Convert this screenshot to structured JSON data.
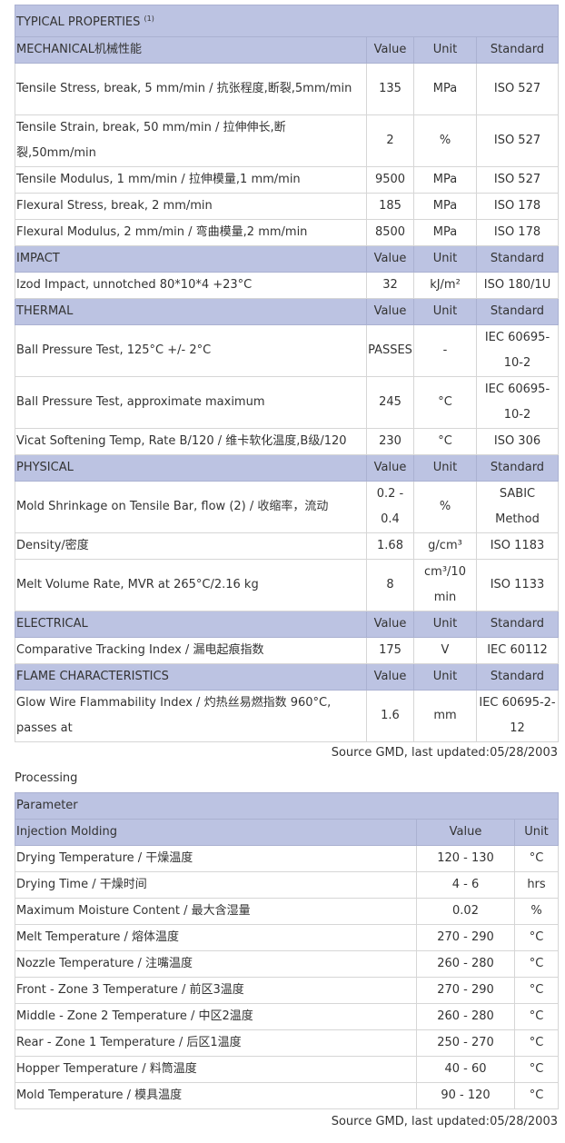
{
  "typical": {
    "title": "TYPICAL PROPERTIES",
    "title_note": "(1)",
    "sections": [
      {
        "name": "MECHANICAL机械性能",
        "col_value": "Value",
        "col_unit": "Unit",
        "col_standard": "Standard",
        "rows": [
          {
            "property": "Tensile Stress, break, 5 mm/min / 抗张程度,断裂,5mm/min",
            "value": "135",
            "unit": "MPa",
            "standard": "ISO 527"
          },
          {
            "property": "Tensile Strain, break, 50 mm/min / 拉伸伸长,断裂,50mm/min",
            "value": "2",
            "unit": "%",
            "standard": "ISO 527"
          },
          {
            "property": "Tensile Modulus, 1 mm/min / 拉伸模量,1 mm/min",
            "value": "9500",
            "unit": "MPa",
            "standard": "ISO 527"
          },
          {
            "property": "Flexural Stress, break, 2 mm/min",
            "value": "185",
            "unit": "MPa",
            "standard": "ISO 178"
          },
          {
            "property": "Flexural Modulus, 2 mm/min / 弯曲模量,2 mm/min",
            "value": "8500",
            "unit": "MPa",
            "standard": "ISO 178"
          }
        ]
      },
      {
        "name": "IMPACT",
        "col_value": "Value",
        "col_unit": "Unit",
        "col_standard": "Standard",
        "rows": [
          {
            "property": "Izod Impact, unnotched 80*10*4 +23°C",
            "value": "32",
            "unit": "kJ/m²",
            "standard": "ISO 180/1U"
          }
        ]
      },
      {
        "name": "THERMAL",
        "col_value": "Value",
        "col_unit": "Unit",
        "col_standard": "Standard",
        "rows": [
          {
            "property": "Ball Pressure Test, 125°C +/- 2°C",
            "value": "PASSES",
            "unit": "-",
            "standard": "IEC 60695-10-2"
          },
          {
            "property": "Ball Pressure Test, approximate maximum",
            "value": "245",
            "unit": "°C",
            "standard": "IEC 60695-10-2"
          },
          {
            "property": "Vicat Softening Temp, Rate B/120 / 维卡软化温度,B级/120",
            "value": "230",
            "unit": "°C",
            "standard": "ISO 306"
          }
        ]
      },
      {
        "name": "PHYSICAL",
        "col_value": "Value",
        "col_unit": "Unit",
        "col_standard": "Standard",
        "rows": [
          {
            "property": "Mold Shrinkage on Tensile Bar, flow (2) / 收缩率，流动",
            "value": "0.2 - 0.4",
            "unit": "%",
            "standard": "SABIC Method"
          },
          {
            "property": "Density/密度",
            "value": "1.68",
            "unit": "g/cm³",
            "standard": "ISO 1183"
          },
          {
            "property": "Melt Volume Rate, MVR at 265°C/2.16 kg",
            "value": "8",
            "unit": "cm³/10 min",
            "standard": "ISO 1133"
          }
        ]
      },
      {
        "name": "ELECTRICAL",
        "col_value": "Value",
        "col_unit": "Unit",
        "col_standard": "Standard",
        "rows": [
          {
            "property": "Comparative Tracking Index / 漏电起痕指数",
            "value": "175",
            "unit": "V",
            "standard": "IEC 60112"
          }
        ]
      },
      {
        "name": "FLAME CHARACTERISTICS",
        "col_value": "Value",
        "col_unit": "Unit",
        "col_standard": "Standard",
        "rows": [
          {
            "property": "Glow Wire Flammability Index / 灼热丝易燃指数 960°C, passes at",
            "value": "1.6",
            "unit": "mm",
            "standard": "IEC 60695-2-12"
          }
        ]
      }
    ],
    "source": "Source GMD, last updated:05/28/2003"
  },
  "processing": {
    "label": "Processing",
    "header_parameter": "Parameter",
    "section_name": "Injection Molding",
    "col_value": "Value",
    "col_unit": "Unit",
    "rows": [
      {
        "parameter": "Drying Temperature / 干燥温度",
        "value": "120 - 130",
        "unit": "°C"
      },
      {
        "parameter": "Drying Time / 干燥时间",
        "value": "4 - 6",
        "unit": "hrs"
      },
      {
        "parameter": "Maximum Moisture Content / 最大含湿量",
        "value": "0.02",
        "unit": "%"
      },
      {
        "parameter": "Melt Temperature / 熔体温度",
        "value": "270 - 290",
        "unit": "°C"
      },
      {
        "parameter": "Nozzle Temperature / 注嘴温度",
        "value": "260 - 280",
        "unit": "°C"
      },
      {
        "parameter": "Front - Zone 3 Temperature / 前区3温度",
        "value": "270 - 290",
        "unit": "°C"
      },
      {
        "parameter": "Middle - Zone 2 Temperature / 中区2温度",
        "value": "260 - 280",
        "unit": "°C"
      },
      {
        "parameter": "Rear - Zone 1 Temperature / 后区1温度",
        "value": "250 - 270",
        "unit": "°C"
      },
      {
        "parameter": "Hopper Temperature / 料筒温度",
        "value": "40 - 60",
        "unit": "°C"
      },
      {
        "parameter": "Mold Temperature / 模具温度",
        "value": "90 - 120",
        "unit": "°C"
      }
    ],
    "source": "Source GMD, last updated:05/28/2003"
  }
}
